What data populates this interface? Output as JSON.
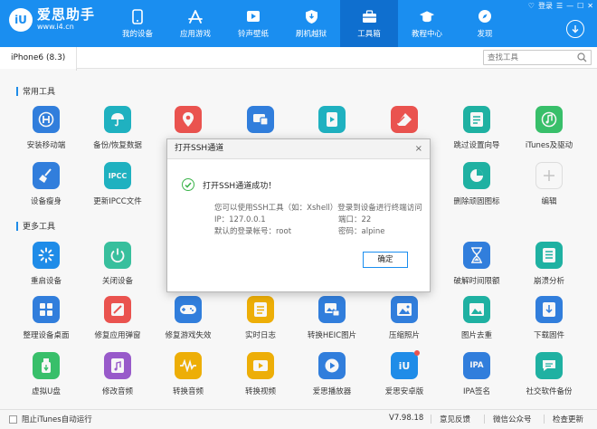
{
  "header": {
    "logo_mark": "iU",
    "logo_name": "爱思助手",
    "logo_url": "www.i4.cn",
    "nav": [
      {
        "label": "我的设备",
        "icon": "phone-icon"
      },
      {
        "label": "应用游戏",
        "icon": "app-store-icon"
      },
      {
        "label": "铃声壁纸",
        "icon": "media-icon"
      },
      {
        "label": "刷机越狱",
        "icon": "shield-icon"
      },
      {
        "label": "工具箱",
        "icon": "toolbox-icon",
        "active": true
      },
      {
        "label": "教程中心",
        "icon": "graduation-cap-icon"
      },
      {
        "label": "发现",
        "icon": "compass-icon"
      }
    ],
    "window_controls": [
      "♡",
      "登录",
      "☰",
      "—",
      "☐",
      "✕"
    ]
  },
  "device_tab": "iPhone6 (8.3)",
  "search": {
    "placeholder": "查找工具"
  },
  "sections": {
    "common": "常用工具",
    "more": "更多工具"
  },
  "tools": {
    "row1": [
      "安装移动端",
      "备份/恢复数据",
      "",
      "",
      "",
      "",
      "跳过设置向导",
      "iTunes及驱动"
    ],
    "row2": [
      "设备瘦身",
      "更新IPCC文件",
      "",
      "",
      "",
      "",
      "删除顽固图标",
      "编辑"
    ],
    "row3": [
      "重启设备",
      "关闭设备",
      "",
      "",
      "",
      "",
      "破解时间限额",
      "崩溃分析"
    ],
    "row4": [
      "整理设备桌面",
      "修复应用弹窗",
      "修复游戏失效",
      "实时日志",
      "转换HEIC图片",
      "压缩照片",
      "图片去重",
      "下载固件"
    ],
    "row5": [
      "虚拟U盘",
      "修改音频",
      "转换音频",
      "转换视频",
      "爱思播放器",
      "爱思安卓版",
      "IPA签名",
      "社交软件备份"
    ]
  },
  "icon_glyphs": {
    "ipcc": "IPCC",
    "ipa": "IPA",
    "iu": "iU"
  },
  "colors": {
    "brand": "#1a8ef0",
    "success": "#3bb34a"
  },
  "dialog": {
    "title": "打开SSH通道",
    "close": "×",
    "message": "打开SSH通道成功！",
    "info_line": "您可以使用SSH工具（如：Xshell）登录到设备进行终端访问",
    "ip_label": "IP：127.0.0.1",
    "port_label": "端口：22",
    "user_label": "默认的登录帐号：root",
    "password_label": "密码：alpine",
    "ok_button": "确定"
  },
  "footer": {
    "checkbox_label": "阻止iTunes自动运行",
    "version": "V7.98.18",
    "feedback": "意见反馈",
    "wechat": "微信公众号",
    "update": "检查更新"
  }
}
